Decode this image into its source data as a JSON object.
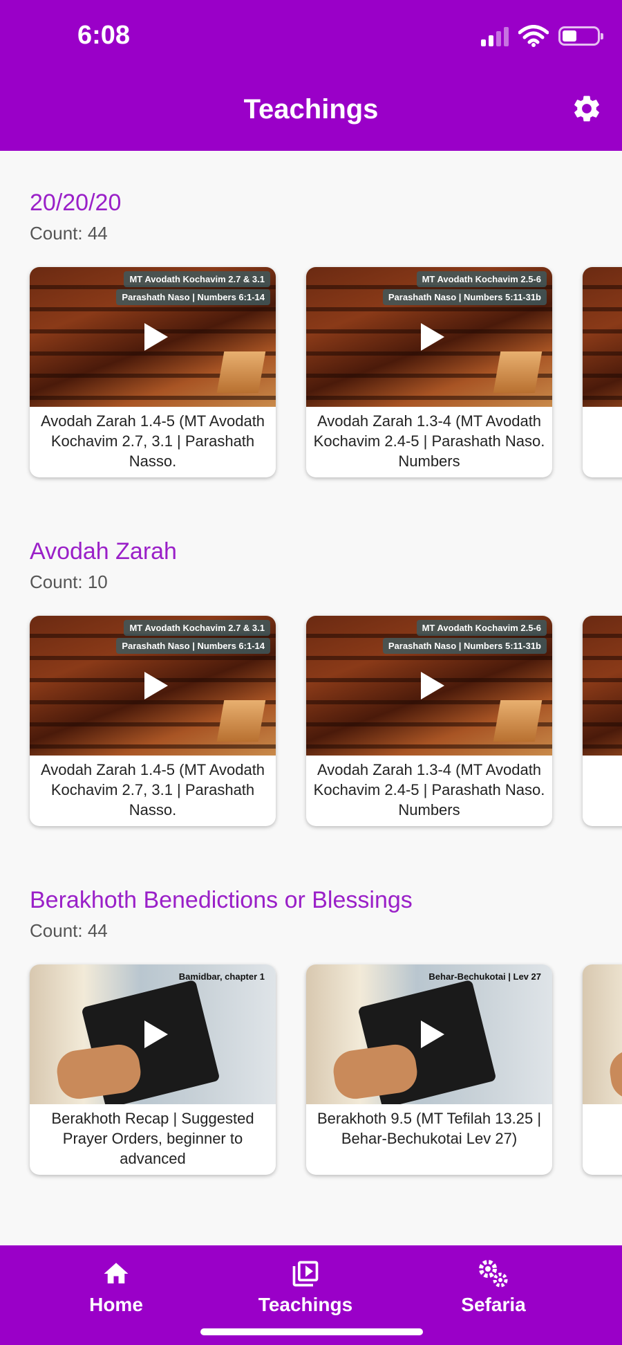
{
  "status_bar": {
    "time": "6:08"
  },
  "header": {
    "title": "Teachings"
  },
  "sections": [
    {
      "title": "20/20/20",
      "count": "Count: 44",
      "cards": [
        {
          "tag1": "MT Avodath Kochavim 2.7 & 3.1",
          "tag2": "Parashath Naso | Numbers 6:1-14",
          "title": "Avodah Zarah 1.4-5 (MT Avodath Kochavim 2.7, 3.1 | Parashath Nasso."
        },
        {
          "tag1": "MT Avodath Kochavim 2.5-6",
          "tag2": "Parashath Naso | Numbers 5:11-31b",
          "title": "Avodah Zarah 1.3-4 (MT Avodath Kochavim 2.4-5 | Parashath Naso. Numbers"
        }
      ]
    },
    {
      "title": "Avodah Zarah",
      "count": "Count: 10",
      "cards": [
        {
          "tag1": "MT Avodath Kochavim 2.7 & 3.1",
          "tag2": "Parashath Naso | Numbers 6:1-14",
          "title": "Avodah Zarah 1.4-5 (MT Avodath Kochavim 2.7, 3.1 | Parashath Nasso."
        },
        {
          "tag1": "MT Avodath Kochavim 2.5-6",
          "tag2": "Parashath Naso | Numbers 5:11-31b",
          "title": "Avodah Zarah 1.3-4 (MT Avodath Kochavim 2.4-5 | Parashath Naso. Numbers"
        }
      ]
    },
    {
      "title": "Berakhoth Benedictions or Blessings",
      "count": "Count: 44",
      "cards": [
        {
          "tag1": "Bamidbar, chapter 1",
          "title": "Berakhoth Recap | Suggested Prayer Orders, beginner to advanced"
        },
        {
          "tag1": "Behar-Bechukotai | Lev 27",
          "title": "Berakhoth 9.5 (MT Tefilah 13.25 | Behar-Bechukotai Lev 27)"
        }
      ]
    }
  ],
  "bottom_nav": {
    "items": [
      {
        "label": "Home",
        "icon": "home-icon"
      },
      {
        "label": "Teachings",
        "icon": "video-library-icon"
      },
      {
        "label": "Sefaria",
        "icon": "gears-icon"
      }
    ]
  },
  "colors": {
    "brand": "#9a00c8",
    "section_title": "#9a20c8"
  }
}
